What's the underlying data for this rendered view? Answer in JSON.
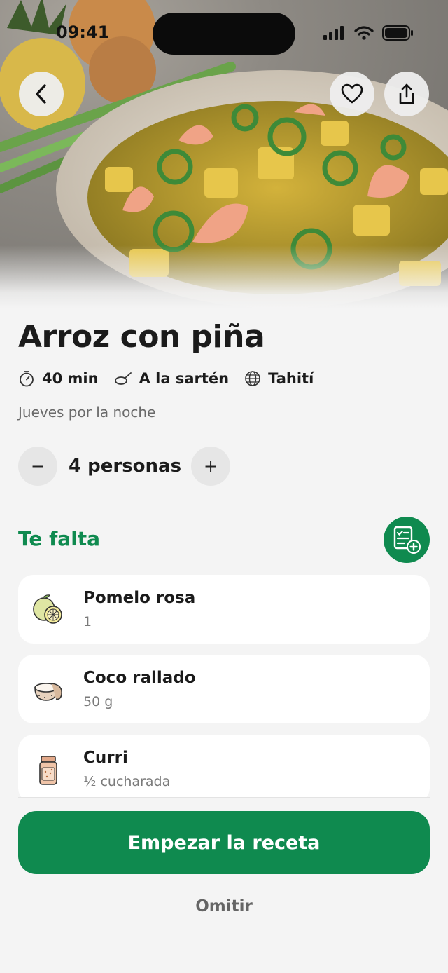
{
  "status_bar": {
    "time": "09:41"
  },
  "recipe": {
    "title": "Arroz con piña",
    "meta": [
      {
        "icon": "timer-icon",
        "label": "40 min"
      },
      {
        "icon": "pan-icon",
        "label": "A la sartén"
      },
      {
        "icon": "globe-icon",
        "label": "Tahití"
      }
    ],
    "subtitle": "Jueves por la noche",
    "servings": {
      "minus": "−",
      "plus": "+",
      "label": "4 personas"
    }
  },
  "missing": {
    "title": "Te falta",
    "items": [
      {
        "name": "Pomelo rosa",
        "qty": "1",
        "icon": "grapefruit-icon"
      },
      {
        "name": "Coco rallado",
        "qty": "50 g",
        "icon": "coconut-icon"
      },
      {
        "name": "Curri",
        "qty": "½ cucharada",
        "icon": "spice-jar-icon"
      }
    ]
  },
  "actions": {
    "start": "Empezar la receta",
    "skip": "Omitir"
  },
  "colors": {
    "accent": "#0f8a4f",
    "background": "#f4f4f4"
  }
}
